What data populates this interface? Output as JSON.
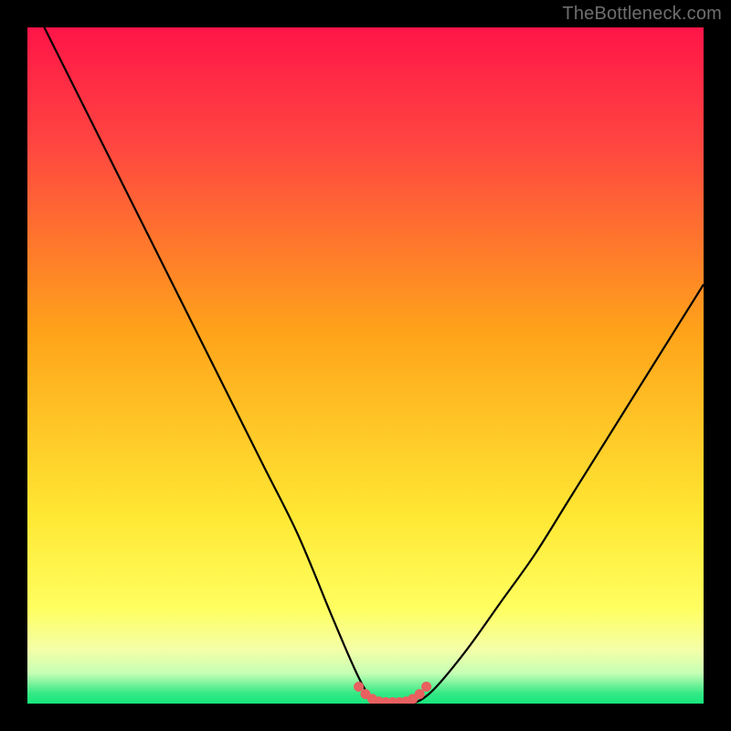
{
  "watermark": "TheBottleneck.com",
  "colors": {
    "frame": "#000000",
    "grad_top": "#ff1548",
    "grad_mid": "#ffa31a",
    "grad_low": "#ffff50",
    "grad_pale": "#f6ffb0",
    "grad_bottom": "#17e67c",
    "curve": "#000000",
    "marker": "#e86060"
  },
  "chart_data": {
    "type": "line",
    "title": "",
    "xlabel": "",
    "ylabel": "",
    "xlim": [
      0,
      100
    ],
    "ylim": [
      0,
      100
    ],
    "series": [
      {
        "name": "bottleneck-curve",
        "x": [
          0,
          5,
          10,
          15,
          20,
          25,
          30,
          35,
          40,
          45,
          48,
          50,
          52,
          55,
          57,
          60,
          65,
          70,
          75,
          80,
          85,
          90,
          95,
          100
        ],
        "y": [
          105,
          95,
          85,
          75,
          65,
          55,
          45,
          35,
          25,
          13,
          6,
          2,
          0,
          0,
          0,
          2,
          8,
          15,
          22,
          30,
          38,
          46,
          54,
          62
        ]
      }
    ],
    "markers": {
      "name": "plateau-markers",
      "points": [
        {
          "x": 49,
          "y": 2.5
        },
        {
          "x": 50,
          "y": 1.4
        },
        {
          "x": 51,
          "y": 0.7
        },
        {
          "x": 52,
          "y": 0.3
        },
        {
          "x": 53,
          "y": 0.2
        },
        {
          "x": 54,
          "y": 0.2
        },
        {
          "x": 55,
          "y": 0.2
        },
        {
          "x": 56,
          "y": 0.3
        },
        {
          "x": 57,
          "y": 0.7
        },
        {
          "x": 58,
          "y": 1.4
        },
        {
          "x": 59,
          "y": 2.5
        }
      ]
    },
    "gradient_stops": [
      {
        "offset": 0.0,
        "color": "#ff1548"
      },
      {
        "offset": 0.18,
        "color": "#ff4840"
      },
      {
        "offset": 0.45,
        "color": "#ffa31a"
      },
      {
        "offset": 0.72,
        "color": "#ffe733"
      },
      {
        "offset": 0.86,
        "color": "#ffff60"
      },
      {
        "offset": 0.92,
        "color": "#f4ffa8"
      },
      {
        "offset": 0.955,
        "color": "#c6ffb4"
      },
      {
        "offset": 0.985,
        "color": "#34e985"
      },
      {
        "offset": 1.0,
        "color": "#17e67c"
      }
    ]
  }
}
